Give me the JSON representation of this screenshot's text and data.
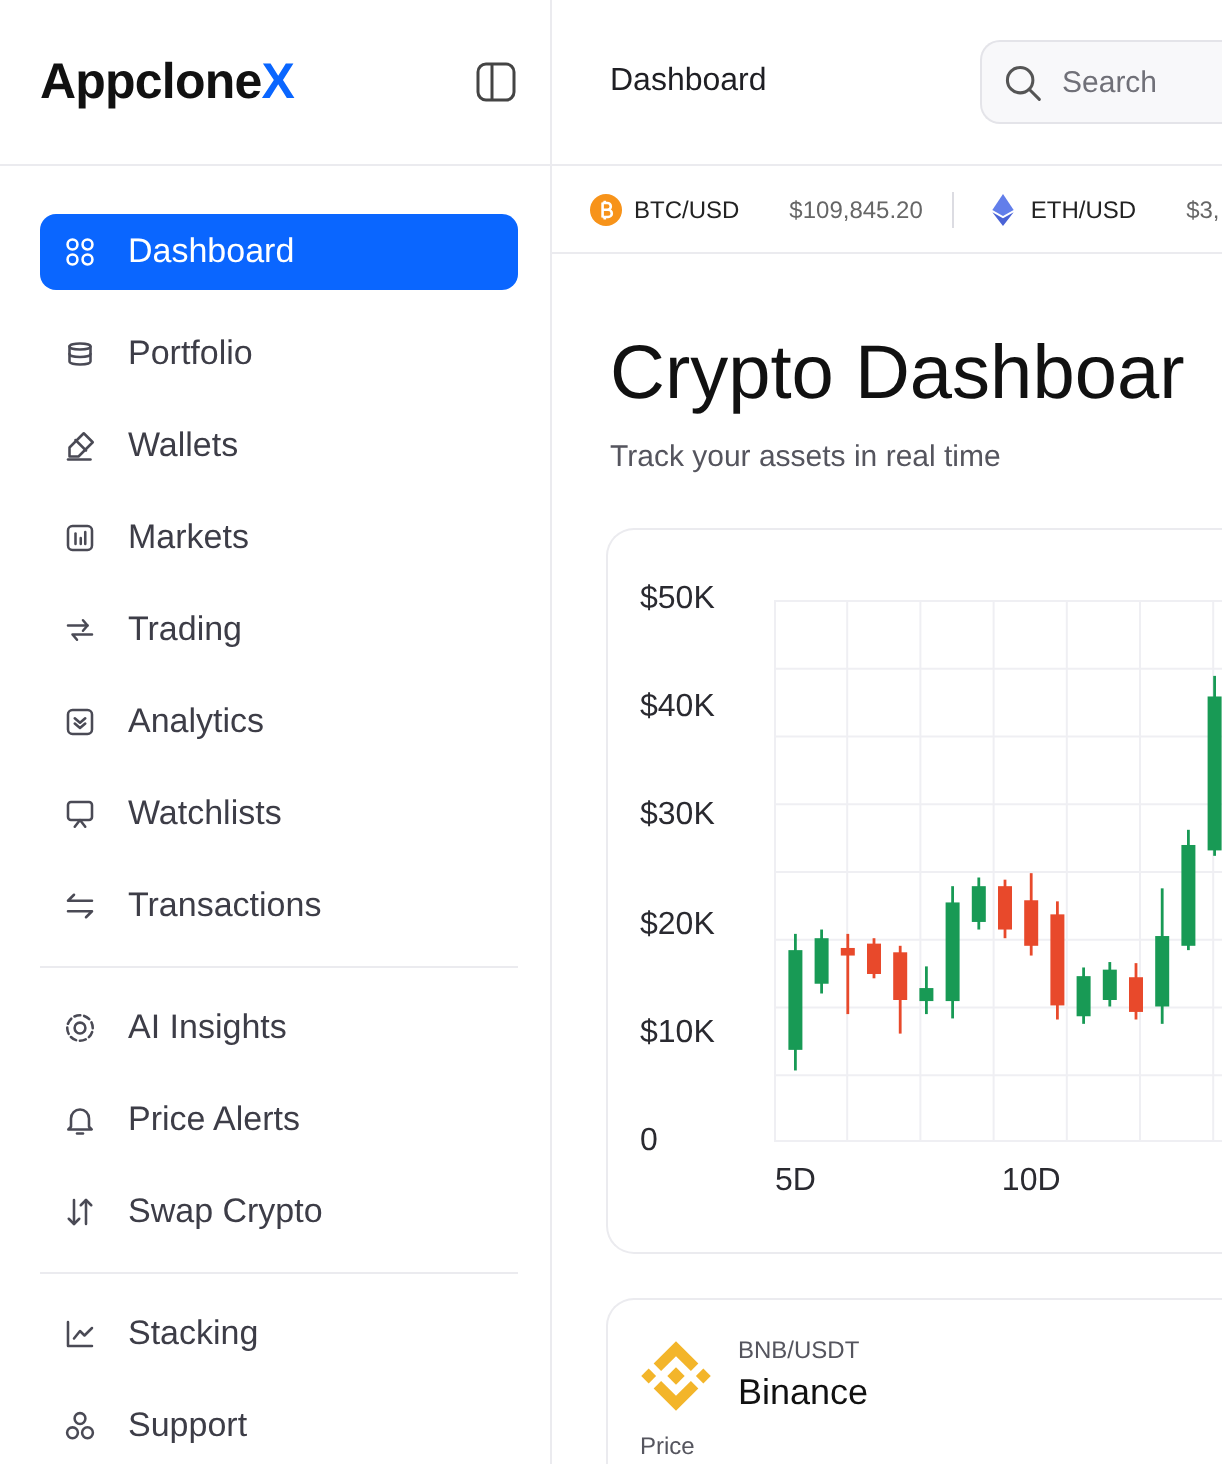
{
  "sidebar": {
    "logo": {
      "text": "Appclone",
      "accent": "X"
    },
    "sections": [
      {
        "items": [
          {
            "label": "Dashboard",
            "selected": true
          },
          {
            "label": "Portfolio",
            "selected": false
          },
          {
            "label": "Wallets",
            "selected": false
          },
          {
            "label": "Markets",
            "selected": false
          },
          {
            "label": "Trading",
            "selected": false
          },
          {
            "label": "Analytics",
            "selected": false
          },
          {
            "label": "Watchlists",
            "selected": false
          },
          {
            "label": "Transactions",
            "selected": false
          }
        ]
      },
      {
        "items": [
          {
            "label": "AI Insights",
            "selected": false
          },
          {
            "label": "Price Alerts",
            "selected": false
          },
          {
            "label": "Swap Crypto",
            "selected": false
          }
        ]
      },
      {
        "items": [
          {
            "label": "Stacking",
            "selected": false
          },
          {
            "label": "Support",
            "selected": false
          }
        ]
      }
    ]
  },
  "header": {
    "title": "Dashboard",
    "search": {
      "placeholder": "Search"
    }
  },
  "ticker": [
    {
      "pair": "BTC/USD",
      "price": "$109,845.20"
    },
    {
      "pair": "ETH/USD",
      "price": "$3,"
    }
  ],
  "page": {
    "title": "Crypto Dashboar",
    "subtitle": "Track your assets in real time"
  },
  "chart": {
    "chart_data": {
      "type": "candlestick",
      "categories": [
        "5D",
        null,
        null,
        null,
        null,
        null,
        null,
        null,
        null,
        "10D",
        null,
        null,
        null,
        null,
        null,
        null,
        null
      ],
      "ohlc": [
        [
          8500,
          19200,
          6600,
          17700
        ],
        [
          14600,
          19600,
          13700,
          18800
        ],
        [
          17900,
          19200,
          11800,
          17200
        ],
        [
          18300,
          18800,
          15100,
          15500
        ],
        [
          17500,
          18100,
          10000,
          13100
        ],
        [
          13000,
          16200,
          11800,
          14200
        ],
        [
          13000,
          23600,
          11400,
          22100
        ],
        [
          20300,
          24400,
          19600,
          23600
        ],
        [
          23600,
          24200,
          18800,
          19600
        ],
        [
          22300,
          24800,
          17200,
          18100
        ],
        [
          21000,
          22200,
          11300,
          12600
        ],
        [
          11600,
          16100,
          10900,
          15300
        ],
        [
          13100,
          16600,
          12500,
          15900
        ],
        [
          15200,
          16500,
          11300,
          12000
        ],
        [
          12500,
          23400,
          10900,
          19000
        ],
        [
          18100,
          28800,
          17700,
          27400
        ],
        [
          26900,
          43000,
          26400,
          41100
        ]
      ],
      "ylim": [
        0,
        50000
      ],
      "yticks": [
        {
          "value": 50000,
          "label": "$50K"
        },
        {
          "value": 40000,
          "label": "$40K"
        },
        {
          "value": 30000,
          "label": "$30K"
        },
        {
          "value": 20000,
          "label": "$20K"
        },
        {
          "value": 10000,
          "label": "$10K"
        },
        {
          "value": 0,
          "label": "0"
        }
      ],
      "grid": true
    }
  },
  "market_card": {
    "pair": "BNB/USDT",
    "name": "Binance",
    "price_label": "Price"
  }
}
